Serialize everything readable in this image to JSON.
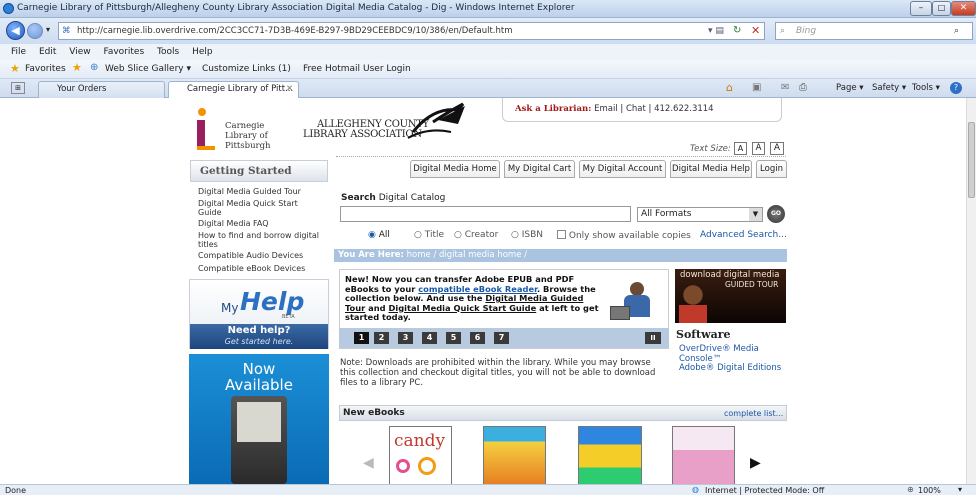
{
  "browser": {
    "title": "Carnegie Library of Pittsburgh/Allegheny County Library Association Digital Media Catalog - Dig - Windows Internet Explorer",
    "url": "http://carnegie.lib.overdrive.com/2CC3CC71-7D3B-469E-B297-9BD29CEEBDC9/10/386/en/Default.htm",
    "search_placeholder": "Bing",
    "menu": [
      "File",
      "Edit",
      "View",
      "Favorites",
      "Tools",
      "Help"
    ],
    "favorites_label": "Favorites",
    "fav_links": [
      "Web Slice Gallery ▾",
      "Customize Links (1)",
      "Free Hotmail",
      "User Login"
    ],
    "tabs": [
      "Your Orders",
      "Carnegie Library of Pitt..."
    ],
    "command_bar": [
      "Page ▾",
      "Safety ▾",
      "Tools ▾"
    ],
    "status": {
      "left": "Done",
      "zone": "Internet | Protected Mode: Off",
      "zoom": "100%"
    }
  },
  "site": {
    "clp_logo": [
      "Carnegie",
      "Library of",
      "Pittsburgh"
    ],
    "acla_logo": [
      "ALLEGHENY COUNTY",
      "LIBRARY ASSOCIATION"
    ],
    "ask": {
      "label": "Ask a Librarian:",
      "email": "Email",
      "chat": "Chat",
      "phone": "412.622.3114"
    },
    "text_size_label": "Text Size:",
    "text_sizes": [
      "A",
      "A",
      "A"
    ],
    "nav": [
      "Digital Media Home",
      "My Digital Cart",
      "My Digital Account",
      "Digital Media Help",
      "Login"
    ],
    "getting_started": {
      "title": "Getting Started",
      "items": [
        "Digital Media Guided Tour",
        "Digital Media Quick Start Guide",
        "Digital Media FAQ",
        "How to find and borrow digital titles",
        "Compatible Audio Devices",
        "Compatible eBook Devices"
      ]
    },
    "help_promo": {
      "my": "My",
      "help": "Help",
      "beta": "BETA",
      "need": "Need help?",
      "sub": "Get started here."
    },
    "now_available": [
      "Now",
      "Available"
    ],
    "search": {
      "label_bold": "Search",
      "label_rest": "Digital Catalog",
      "format": "All Formats",
      "go": "GO",
      "options": [
        "All",
        "Title",
        "Creator",
        "ISBN"
      ],
      "only_available": "Only show available copies",
      "advanced": "Advanced Search..."
    },
    "breadcrumb": {
      "label": "You Are Here:",
      "path": "home / digital media home /"
    },
    "promo": {
      "part1": "New! Now you can transfer Adobe EPUB and PDF eBooks to your ",
      "link1": "compatible eBook Reader",
      "part2": ". Browse the collection below. And use the ",
      "link2": "Digital Media Guided Tour",
      "part3": " and ",
      "link3": "Digital Media Quick Start Guide",
      "part4": " at left to get started today.",
      "pages": [
        "1",
        "2",
        "3",
        "4",
        "5",
        "6",
        "7"
      ],
      "pause": "II"
    },
    "guided_tour": {
      "line1": "download digital media",
      "line2": "GUIDED TOUR"
    },
    "software": {
      "title": "Software",
      "links": [
        "OverDrive® Media Console™",
        "Adobe® Digital Editions"
      ]
    },
    "note": "Note: Downloads are prohibited within the library. While you may browse this collection and checkout digital titles, you will not be able to download files to a library PC.",
    "new_ebooks": {
      "title": "New eBooks",
      "more": "complete list...",
      "candy": "candy"
    }
  }
}
